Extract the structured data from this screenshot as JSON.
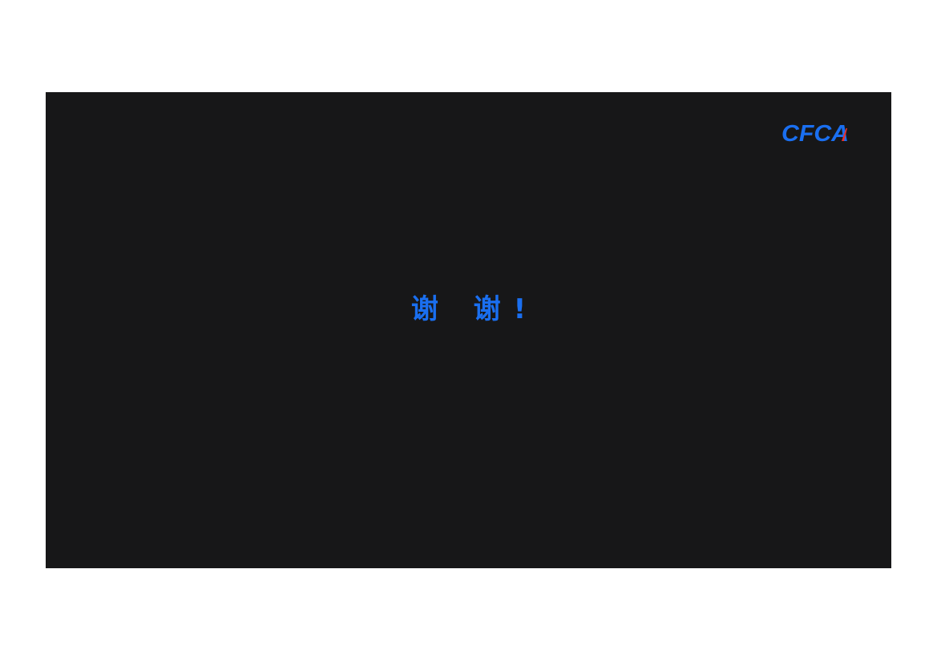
{
  "slide": {
    "background_color": "#171718",
    "logo": {
      "text": "CFCA",
      "icon": "cfca-logo",
      "color": "#1a6ff0",
      "accent_color": "#e8322b"
    },
    "message": "谢 谢!",
    "message_color": "#1a6ff0"
  }
}
